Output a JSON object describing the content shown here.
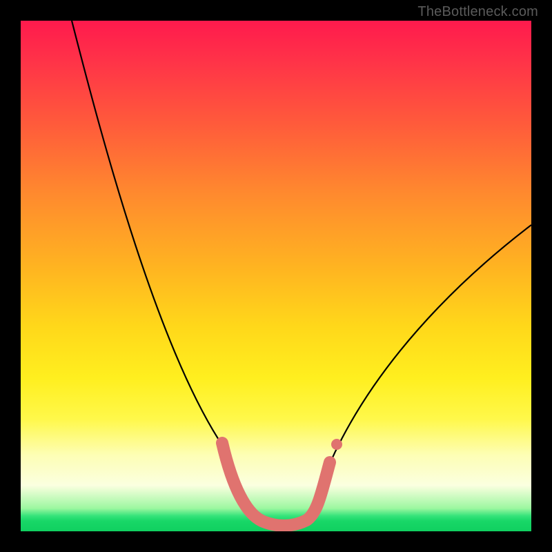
{
  "watermark": "TheBottleneck.com",
  "chart_data": {
    "type": "line",
    "title": "",
    "xlabel": "",
    "ylabel": "",
    "xlim": [
      0,
      100
    ],
    "ylim": [
      0,
      100
    ],
    "grid": false,
    "legend": false,
    "series": [
      {
        "name": "bottleneck-curve",
        "x": [
          10,
          15,
          20,
          25,
          30,
          35,
          40,
          43,
          46,
          49,
          52,
          55,
          60,
          65,
          70,
          75,
          80,
          85,
          90,
          95,
          100
        ],
        "values": [
          100,
          86,
          72,
          58,
          44,
          30,
          16,
          8,
          3,
          1,
          1,
          2,
          6,
          12,
          19,
          26,
          33,
          40,
          47,
          53,
          60
        ]
      }
    ],
    "highlight_segment": {
      "name": "trough-marker",
      "x": [
        40,
        43,
        46,
        49,
        52,
        55,
        58
      ],
      "values": [
        16,
        8,
        3,
        1,
        1,
        2,
        6
      ]
    },
    "colors": {
      "curve": "#000000",
      "trough": "#e0736f",
      "gradient_top": "#ff1a4d",
      "gradient_mid": "#ffd81a",
      "gradient_bottom": "#10d060"
    }
  }
}
